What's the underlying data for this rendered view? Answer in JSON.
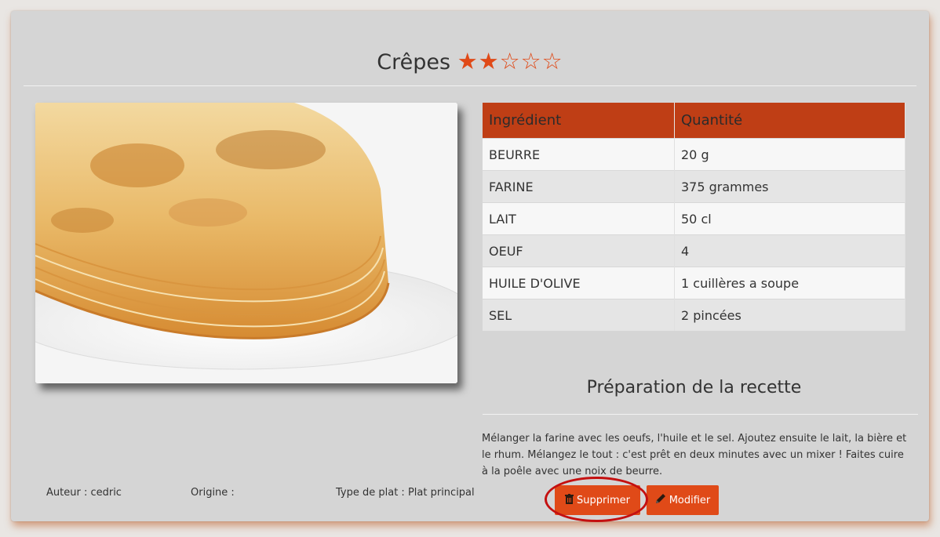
{
  "recipe": {
    "title": "Crêpes",
    "rating": 2,
    "rating_max": 5,
    "stars_display": "★★☆☆☆"
  },
  "ingredients": {
    "headers": [
      "Ingrédient",
      "Quantité"
    ],
    "rows": [
      [
        "BEURRE",
        "20 g"
      ],
      [
        "FARINE",
        "375 grammes"
      ],
      [
        "LAIT",
        "50 cl"
      ],
      [
        "OEUF",
        "4"
      ],
      [
        "HUILE D'OLIVE",
        "1 cuillères a soupe"
      ],
      [
        "SEL",
        "2 pincées"
      ]
    ]
  },
  "preparation": {
    "title": "Préparation de la recette",
    "text": "Mélanger la farine avec les oeufs, l'huile et le sel. Ajoutez ensuite le lait, la bière et le rhum. Mélangez le tout : c'est prêt en deux minutes avec un mixer ! Faites cuire à la poêle avec une noix de beurre."
  },
  "meta": {
    "author": "Auteur : cedric",
    "origin": "Origine :",
    "dish_type": "Type de plat : Plat principal"
  },
  "actions": {
    "delete_label": "Supprimer",
    "edit_label": "Modifier",
    "delete_icon": "trash-icon",
    "edit_icon": "pencil-icon"
  },
  "colors": {
    "accent": "#e04a18",
    "table_header": "#bf3e15",
    "highlight_circle": "#c41010"
  }
}
